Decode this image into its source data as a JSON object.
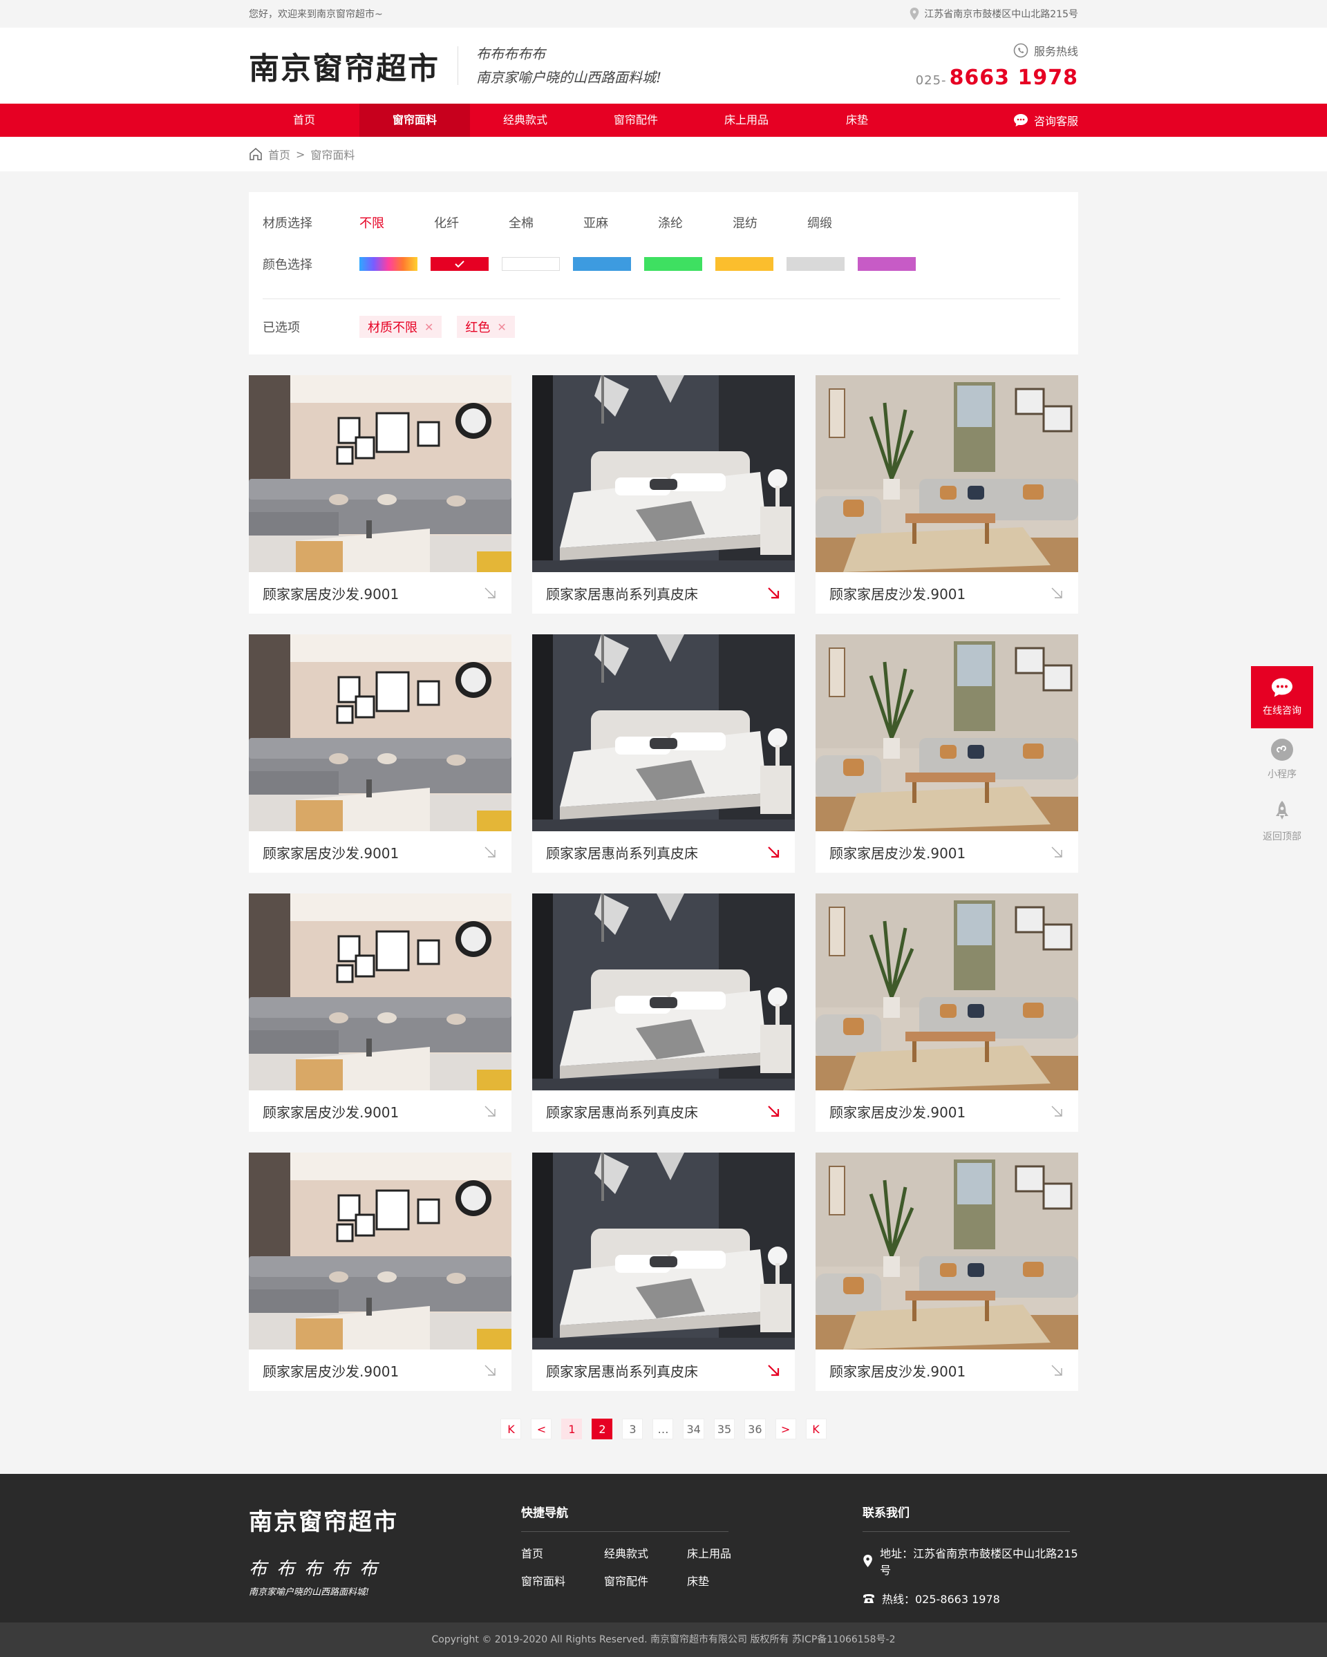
{
  "topbar": {
    "welcome": "您好，欢迎来到南京窗帘超市~",
    "address": "江苏省南京市鼓楼区中山北路215号"
  },
  "header": {
    "logo": "南京窗帘超市",
    "slogan_line1": "布布布布布",
    "slogan_line2": "南京家喻户晓的山西路面料城!",
    "hotline_label": "服务热线",
    "hotline_prefix": "025-",
    "hotline_number": "8663 1978"
  },
  "nav": {
    "items": [
      "首页",
      "窗帘面料",
      "经典款式",
      "窗帘配件",
      "床上用品",
      "床垫"
    ],
    "active_index": 1,
    "consult": "咨询客服"
  },
  "breadcrumb": {
    "home": "首页",
    "sep": ">",
    "current": "窗帘面料"
  },
  "filter": {
    "material_label": "材质选择",
    "materials": [
      "不限",
      "化纤",
      "全棉",
      "亚麻",
      "涤纶",
      "混纺",
      "绸缎"
    ],
    "material_active": 0,
    "color_label": "颜色选择",
    "colors": [
      "rainbow",
      "#e60023",
      "#ffffff",
      "#3d9be0",
      "#3ee061",
      "#fbbe2d",
      "#d9d9d9",
      "#c75bc6"
    ],
    "color_active": 1,
    "selected_label": "已选项",
    "selected": [
      "材质不限",
      "红色"
    ]
  },
  "products": [
    {
      "title": "顾家家居皮沙发.9001",
      "image": "living-room-sofa",
      "highlight": false
    },
    {
      "title": "顾家家居惠尚系列真皮床",
      "image": "bedroom-bed",
      "highlight": true
    },
    {
      "title": "顾家家居皮沙发.9001",
      "image": "sunroom-sofa",
      "highlight": false
    },
    {
      "title": "顾家家居皮沙发.9001",
      "image": "living-room-sofa",
      "highlight": false
    },
    {
      "title": "顾家家居惠尚系列真皮床",
      "image": "bedroom-bed",
      "highlight": true
    },
    {
      "title": "顾家家居皮沙发.9001",
      "image": "sunroom-sofa",
      "highlight": false
    },
    {
      "title": "顾家家居皮沙发.9001",
      "image": "living-room-sofa",
      "highlight": false
    },
    {
      "title": "顾家家居惠尚系列真皮床",
      "image": "bedroom-bed",
      "highlight": true
    },
    {
      "title": "顾家家居皮沙发.9001",
      "image": "sunroom-sofa",
      "highlight": false
    },
    {
      "title": "顾家家居皮沙发.9001",
      "image": "living-room-sofa",
      "highlight": false
    },
    {
      "title": "顾家家居惠尚系列真皮床",
      "image": "bedroom-bed",
      "highlight": true
    },
    {
      "title": "顾家家居皮沙发.9001",
      "image": "sunroom-sofa",
      "highlight": false
    }
  ],
  "pagination": {
    "first": "K",
    "prev": "<",
    "pages": [
      "1",
      "2",
      "3",
      "…",
      "34",
      "35",
      "36"
    ],
    "current": "2",
    "next": ">",
    "last": "K"
  },
  "sidebar": {
    "consult": "在线咨询",
    "miniapp": "小程序",
    "top": "返回顶部"
  },
  "footer": {
    "logo": "南京窗帘超市",
    "slogan_line1": "布布布布布",
    "slogan_line2": "南京家喻户晓的山西路面料城!",
    "nav_title": "快捷导航",
    "nav_links": [
      "首页",
      "经典款式",
      "床上用品",
      "窗帘面料",
      "窗帘配件",
      "床垫"
    ],
    "contact_title": "联系我们",
    "address": "地址：江苏省南京市鼓楼区中山北路215号",
    "phone": "热线：025-8663 1978",
    "copyright": "Copyright © 2019-2020 All Rights Reserved. 南京窗帘超市有限公司 版权所有 苏ICP备11066158号-2"
  },
  "theme": {
    "accent": "#e60023"
  }
}
